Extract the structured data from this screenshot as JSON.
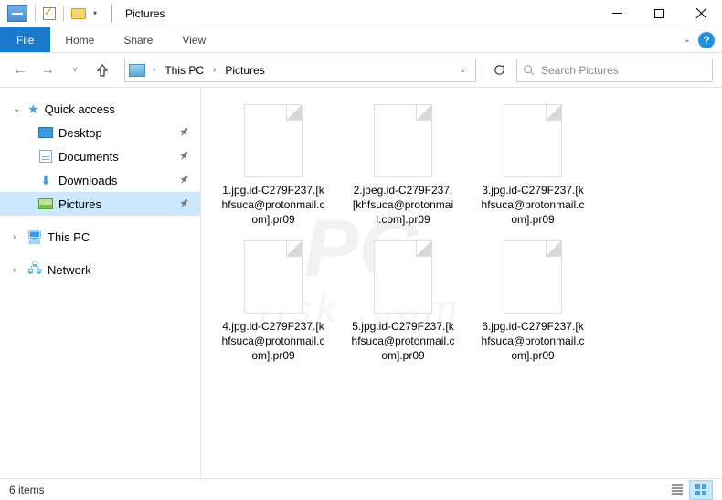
{
  "window": {
    "title": "Pictures"
  },
  "ribbon": {
    "file": "File",
    "tabs": [
      "Home",
      "Share",
      "View"
    ]
  },
  "breadcrumbs": [
    "This PC",
    "Pictures"
  ],
  "search": {
    "placeholder": "Search Pictures"
  },
  "sidebar": {
    "quick_access": "Quick access",
    "items": [
      {
        "label": "Desktop"
      },
      {
        "label": "Documents"
      },
      {
        "label": "Downloads"
      },
      {
        "label": "Pictures"
      }
    ],
    "this_pc": "This PC",
    "network": "Network"
  },
  "files": [
    {
      "name": "1.jpg.id-C279F237.[khfsuca@protonmail.com].pr09"
    },
    {
      "name": "2.jpeg.id-C279F237.[khfsuca@protonmail.com].pr09"
    },
    {
      "name": "3.jpg.id-C279F237.[khfsuca@protonmail.com].pr09"
    },
    {
      "name": "4.jpg.id-C279F237.[khfsuca@protonmail.com].pr09"
    },
    {
      "name": "5.jpg.id-C279F237.[khfsuca@protonmail.com].pr09"
    },
    {
      "name": "6.jpg.id-C279F237.[khfsuca@protonmail.com].pr09"
    }
  ],
  "status": {
    "count": "6 items"
  }
}
